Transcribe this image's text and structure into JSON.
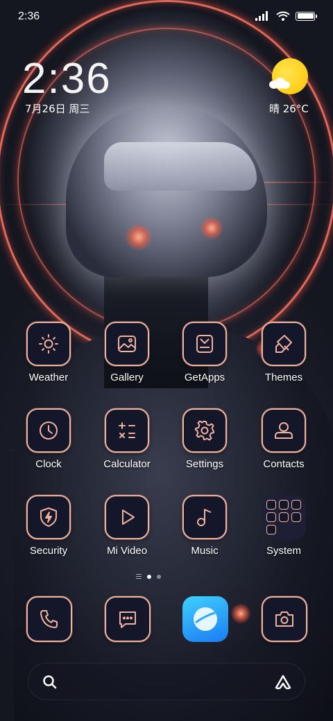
{
  "status_bar": {
    "time": "2:36"
  },
  "clock_widget": {
    "time": "2:36",
    "date": "7月26日 周三",
    "weather": "晴 26°C"
  },
  "apps_row1": [
    {
      "label": "Weather",
      "icon": "sun-icon"
    },
    {
      "label": "Gallery",
      "icon": "image-icon"
    },
    {
      "label": "GetApps",
      "icon": "store-icon"
    },
    {
      "label": "Themes",
      "icon": "brush-icon"
    }
  ],
  "apps_row2": [
    {
      "label": "Clock",
      "icon": "clock-icon"
    },
    {
      "label": "Calculator",
      "icon": "calculator-icon"
    },
    {
      "label": "Settings",
      "icon": "gear-icon"
    },
    {
      "label": "Contacts",
      "icon": "person-icon"
    }
  ],
  "apps_row3": [
    {
      "label": "Security",
      "icon": "shield-icon"
    },
    {
      "label": "Mi Video",
      "icon": "play-icon"
    },
    {
      "label": "Music",
      "icon": "music-note-icon"
    },
    {
      "label": "System",
      "icon": "folder-icon"
    }
  ],
  "dock": [
    {
      "icon": "phone-icon"
    },
    {
      "icon": "message-icon"
    },
    {
      "icon": "browser-icon"
    },
    {
      "icon": "camera-icon"
    }
  ],
  "page_indicator": {
    "pages": 2,
    "active": 1
  },
  "colors": {
    "icon_border": "#f1b39d",
    "icon_bg": "#14162a",
    "ring": "#ff7864"
  }
}
